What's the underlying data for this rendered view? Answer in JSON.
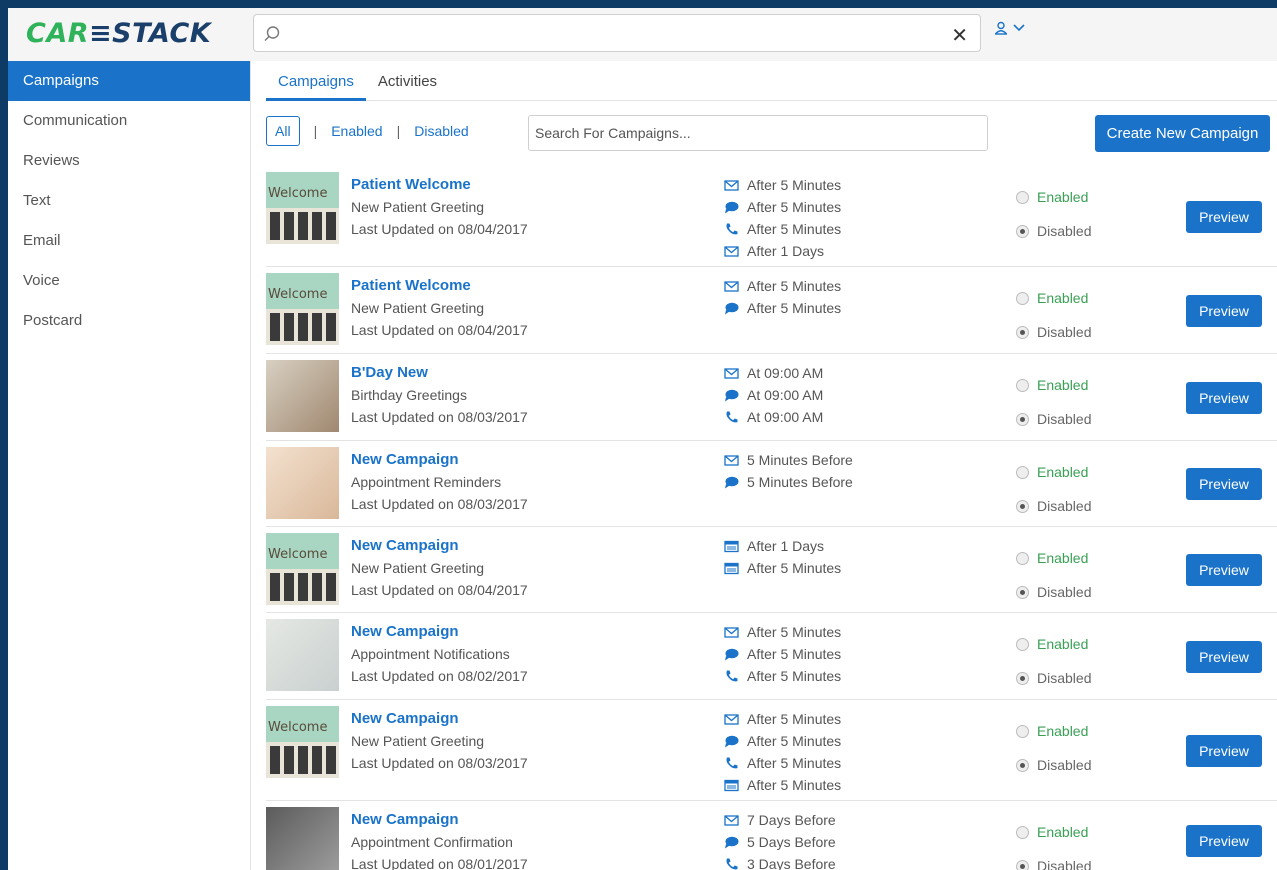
{
  "header": {
    "logo_part1": "CAR",
    "logo_part2": "≡STACK",
    "search_placeholder": "",
    "clear_icon": "close-icon",
    "user_icon": "user-icon"
  },
  "sidebar": {
    "items": [
      {
        "label": "Campaigns",
        "active": true
      },
      {
        "label": "Communication"
      },
      {
        "label": "Reviews"
      },
      {
        "label": "Text"
      },
      {
        "label": "Email"
      },
      {
        "label": "Voice"
      },
      {
        "label": "Postcard"
      }
    ]
  },
  "tabs": [
    {
      "label": "Campaigns",
      "active": true
    },
    {
      "label": "Activities"
    }
  ],
  "filters": {
    "all": "All",
    "enabled": "Enabled",
    "disabled": "Disabled",
    "separator": "|",
    "search_placeholder": "Search For Campaigns...",
    "create_button": "Create New Campaign"
  },
  "labels": {
    "enabled": "Enabled",
    "disabled": "Disabled",
    "preview": "Preview"
  },
  "campaigns": [
    {
      "title": "Patient Welcome",
      "type": "New Patient Greeting",
      "updated": "Last Updated on 08/04/2017",
      "thumb": "welcome",
      "schedule": [
        {
          "icon": "email",
          "text": "After 5 Minutes"
        },
        {
          "icon": "chat",
          "text": "After 5 Minutes"
        },
        {
          "icon": "phone",
          "text": "After 5 Minutes"
        },
        {
          "icon": "email",
          "text": "After 1 Days"
        }
      ]
    },
    {
      "title": "Patient Welcome",
      "type": "New Patient Greeting",
      "updated": "Last Updated on 08/04/2017",
      "thumb": "welcome",
      "schedule": [
        {
          "icon": "email",
          "text": "After 5 Minutes"
        },
        {
          "icon": "chat",
          "text": "After 5 Minutes"
        }
      ]
    },
    {
      "title": "B'Day New",
      "type": "Birthday Greetings",
      "updated": "Last Updated on 08/03/2017",
      "thumb": "gift",
      "schedule": [
        {
          "icon": "email",
          "text": "At 09:00 AM"
        },
        {
          "icon": "chat",
          "text": "At 09:00 AM"
        },
        {
          "icon": "phone",
          "text": "At 09:00 AM"
        }
      ]
    },
    {
      "title": "New Campaign",
      "type": "Appointment Reminders",
      "updated": "Last Updated on 08/03/2017",
      "thumb": "pen",
      "schedule": [
        {
          "icon": "email",
          "text": "5 Minutes Before"
        },
        {
          "icon": "chat",
          "text": "5 Minutes Before"
        }
      ]
    },
    {
      "title": "New Campaign",
      "type": "New Patient Greeting",
      "updated": "Last Updated on 08/04/2017",
      "thumb": "welcome",
      "schedule": [
        {
          "icon": "postcard",
          "text": "After 1 Days"
        },
        {
          "icon": "postcard",
          "text": "After 5 Minutes"
        }
      ]
    },
    {
      "title": "New Campaign",
      "type": "Appointment Notifications",
      "updated": "Last Updated on 08/02/2017",
      "thumb": "calendar",
      "schedule": [
        {
          "icon": "email",
          "text": "After 5 Minutes"
        },
        {
          "icon": "chat",
          "text": "After 5 Minutes"
        },
        {
          "icon": "phone",
          "text": "After 5 Minutes"
        }
      ]
    },
    {
      "title": "New Campaign",
      "type": "New Patient Greeting",
      "updated": "Last Updated on 08/03/2017",
      "thumb": "welcome",
      "schedule": [
        {
          "icon": "email",
          "text": "After 5 Minutes"
        },
        {
          "icon": "chat",
          "text": "After 5 Minutes"
        },
        {
          "icon": "phone",
          "text": "After 5 Minutes"
        },
        {
          "icon": "postcard",
          "text": "After 5 Minutes"
        }
      ]
    },
    {
      "title": "New Campaign",
      "type": "Appointment Confirmation",
      "updated": "Last Updated on 08/01/2017",
      "thumb": "phone",
      "schedule": [
        {
          "icon": "email",
          "text": "7 Days Before"
        },
        {
          "icon": "chat",
          "text": "5 Days Before"
        },
        {
          "icon": "phone",
          "text": "3 Days Before"
        }
      ]
    }
  ],
  "thumb_text": {
    "welcome": "Welcome"
  },
  "colors": {
    "accent": "#1a73c9",
    "enabled": "#3aa055",
    "frame": "#0d3b66",
    "logo_green": "#2fb35a",
    "logo_navy": "#1b3f6b"
  }
}
